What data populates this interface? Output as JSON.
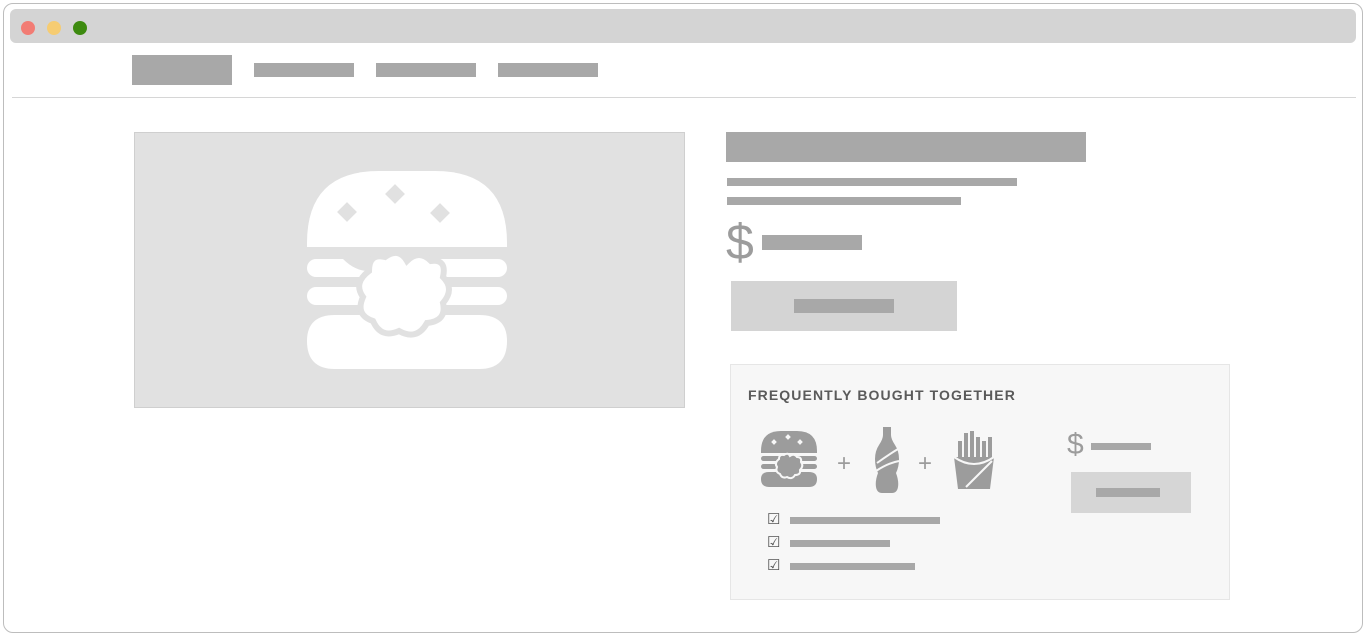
{
  "window": {
    "controls": [
      {
        "name": "close",
        "color": "#f27c74"
      },
      {
        "name": "minimize",
        "color": "#f6cc72"
      },
      {
        "name": "zoom",
        "color": "#3d8a0f"
      }
    ]
  },
  "nav": {
    "items": [
      {
        "id": "logo",
        "label": ""
      },
      {
        "id": "nav-1",
        "label": ""
      },
      {
        "id": "nav-2",
        "label": ""
      },
      {
        "id": "nav-3",
        "label": ""
      }
    ]
  },
  "product": {
    "image_icon": "burger-icon",
    "currency_symbol": "$",
    "add_to_cart_label": ""
  },
  "frequently_bought": {
    "title": "FREQUENTLY BOUGHT TOGETHER",
    "items": [
      {
        "icon": "burger-icon",
        "checked": true,
        "checkmark": "☑"
      },
      {
        "icon": "soda-bottle-icon",
        "checked": true,
        "checkmark": "☑"
      },
      {
        "icon": "fries-icon",
        "checked": true,
        "checkmark": "☑"
      }
    ],
    "plus_symbol": "+",
    "currency_symbol": "$",
    "add_all_label": ""
  },
  "colors": {
    "placeholder": "#a8a8a8",
    "hero_background": "#e1e1e1",
    "panel_background": "#f7f7f7"
  }
}
